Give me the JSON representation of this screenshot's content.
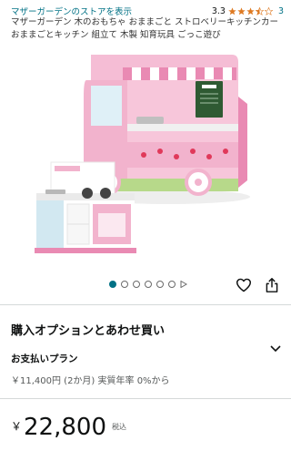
{
  "product": {
    "store_link": "マザーガーデンのストアを表示",
    "rating_value": "3.3",
    "rating_fraction": 0.66,
    "rating_count": "3",
    "title": "マザーガーデン 木のおもちゃ おままごと ストロベリーキッチンカー おままごとキッチン 組立て 木製 知育玩具 ごっこ遊び"
  },
  "gallery": {
    "image_count": 6,
    "active_index": 0
  },
  "purchase": {
    "heading": "購入オプションとあわせ買い",
    "payment_title": "お支払いプラン",
    "payment_detail": "￥11,400円 (2か月) 実質年率 0%から"
  },
  "price": {
    "currency": "￥",
    "amount": "22,800",
    "tax_label": "税込"
  },
  "colors": {
    "link": "#007185",
    "star": "#de7921",
    "truck_pink": "#f2b3cd",
    "truck_pink_dark": "#e98ab3"
  },
  "icons": [
    "star-icon",
    "play-icon",
    "heart-icon",
    "share-icon",
    "chevron-down-icon"
  ]
}
